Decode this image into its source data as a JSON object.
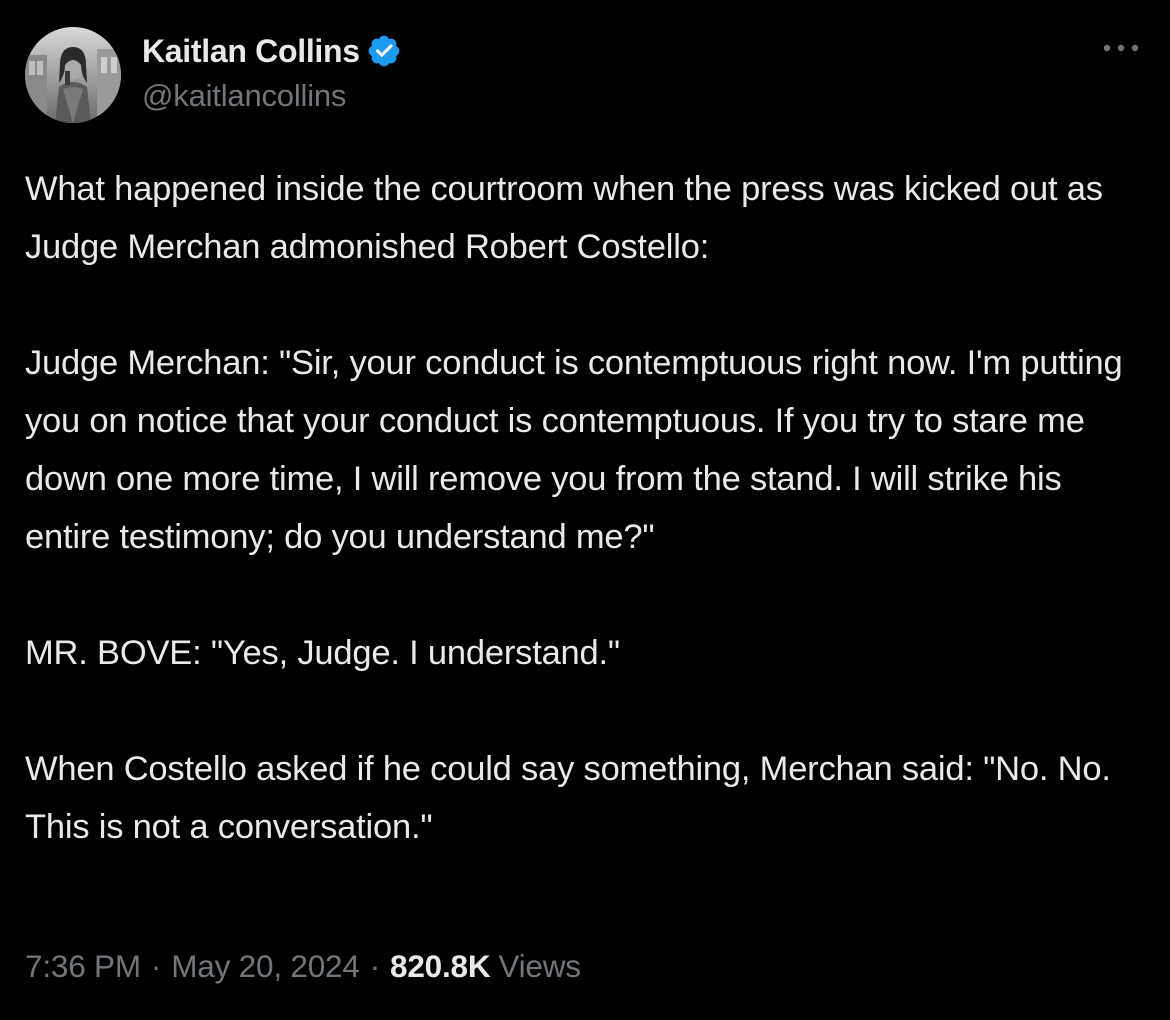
{
  "author": {
    "name": "Kaitlan Collins",
    "handle": "@kaitlancollins",
    "verified": true,
    "avatar_icon": "profile-photo",
    "verified_icon": "verified-badge-icon"
  },
  "menu": {
    "icon": "more-horizontal-icon"
  },
  "tweet": {
    "paragraphs": [
      "What happened inside the courtroom when the press was kicked out as Judge Merchan admonished Robert Costello:",
      "Judge Merchan: \"Sir, your conduct is contemptuous right now. I'm putting you on notice that your conduct is contemptuous. If you try to stare me down one more time, I will remove you from the stand. I will strike his entire testimony; do you understand me?\"",
      "MR. BOVE: \"Yes, Judge. I understand.\"",
      "When Costello asked if he could say something, Merchan said: \"No. No. This is not a conversation.\""
    ],
    "time": "7:36 PM",
    "separator": "·",
    "date": "May 20, 2024",
    "views_count": "820.8K",
    "views_label": "Views"
  },
  "colors": {
    "background": "#000000",
    "text_primary": "#e7e9ea",
    "text_secondary": "#71767b",
    "verified_blue": "#1d9bf0"
  }
}
